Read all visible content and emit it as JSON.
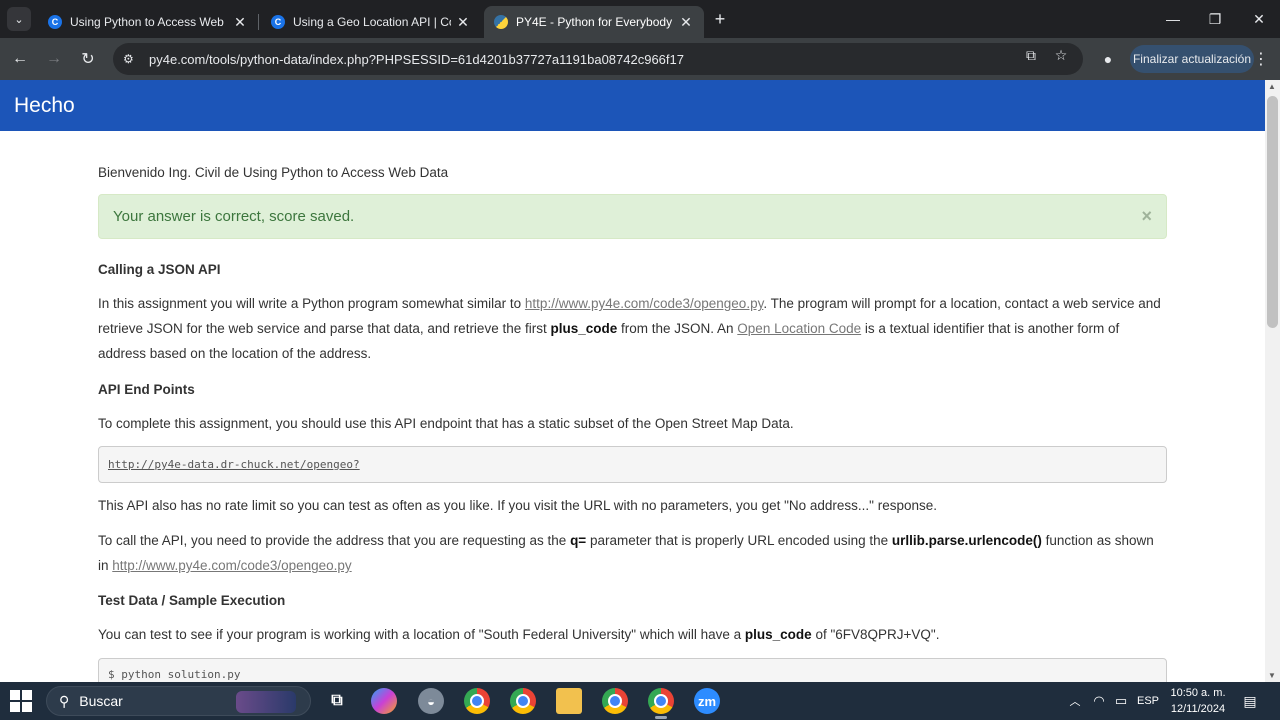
{
  "browser": {
    "tabs": [
      {
        "title": "Using Python to Access Web Da",
        "favicon": "coursera-icon"
      },
      {
        "title": "Using a Geo Location API | Cou",
        "favicon": "coursera-icon"
      },
      {
        "title": "PY4E - Python for Everybody",
        "favicon": "python-icon",
        "active": true
      }
    ],
    "url": "py4e.com/tools/python-data/index.php?PHPSESSID=61d4201b37727a1191ba08742c966f17",
    "update_button": "Finalizar actualización"
  },
  "page": {
    "brand": "Hecho",
    "welcome": "Bienvenido Ing. Civil de Using Python to Access Web Data",
    "alert": "Your answer is correct, score saved.",
    "alert_close": "×",
    "section1_title": "Calling a JSON API",
    "p1": {
      "t1": "In this assignment you will write a Python program somewhat similar to ",
      "link1": "http://www.py4e.com/code3/opengeo.py",
      "t2": ". The program will prompt for a location, contact a web service and retrieve JSON for the web service and parse that data, and retrieve the first ",
      "b1": "plus_code",
      "t3": " from the JSON. An ",
      "link2": "Open Location Code",
      "t4": " is a textual identifier that is another form of address based on the location of the address."
    },
    "section2_title": "API End Points",
    "p2": "To complete this assignment, you should use this API endpoint that has a static subset of the Open Street Map Data.",
    "endpoint": "http://py4e-data.dr-chuck.net/opengeo?",
    "p3": "This API also has no rate limit so you can test as often as you like. If you visit the URL with no parameters, you get \"No address...\" response.",
    "p4": {
      "t1": "To call the API, you need to provide the address that you are requesting as the ",
      "b1": "q=",
      "t2": " parameter that is properly URL encoded using the ",
      "b2": "urllib.parse.urlencode()",
      "t3": " function as shown in ",
      "link": "http://www.py4e.com/code3/opengeo.py"
    },
    "section3_title": "Test Data / Sample Execution",
    "p5": {
      "t1": "You can test to see if your program is working with a location of \"South Federal University\" which will have a ",
      "b1": "plus_code",
      "t2": " of \"6FV8QPRJ+VQ\"."
    },
    "code_line": "$ python solution.py"
  },
  "taskbar": {
    "search_placeholder": "Buscar",
    "zoom_label": "zm",
    "language": "ESP",
    "time": "10:50 a. m.",
    "date": "12/11/2024"
  }
}
